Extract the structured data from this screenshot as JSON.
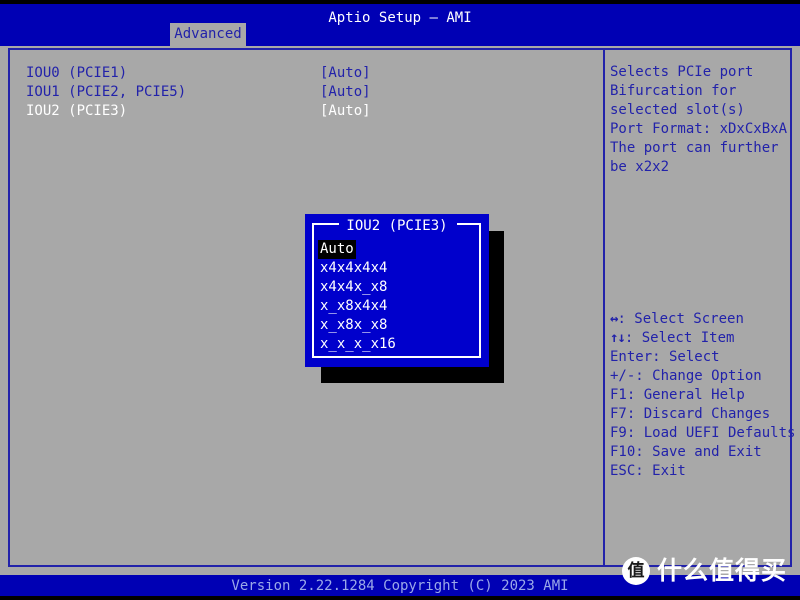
{
  "header": {
    "title": "Aptio Setup – AMI",
    "tab_label": "Advanced"
  },
  "settings": {
    "rows": [
      {
        "label": "IOU0 (PCIE1)",
        "value": "[Auto]",
        "active": false
      },
      {
        "label": "IOU1 (PCIE2, PCIE5)",
        "value": "[Auto]",
        "active": false
      },
      {
        "label": "IOU2 (PCIE3)",
        "value": "[Auto]",
        "active": true
      }
    ]
  },
  "help": {
    "lines": [
      "Selects PCIe port",
      "Bifurcation for",
      "selected slot(s)",
      "Port Format: xDxCxBxA",
      "The port can further",
      "be x2x2"
    ]
  },
  "keys": {
    "lines": [
      {
        "glyph": "↔",
        "text": ": Select Screen"
      },
      {
        "glyph": "↑↓",
        "text": ": Select Item"
      },
      {
        "glyph": "",
        "text": "Enter: Select"
      },
      {
        "glyph": "",
        "text": "+/-: Change Option"
      },
      {
        "glyph": "",
        "text": "F1: General Help"
      },
      {
        "glyph": "",
        "text": "F7: Discard Changes"
      },
      {
        "glyph": "",
        "text": "F9: Load UEFI Defaults"
      },
      {
        "glyph": "",
        "text": "F10: Save and Exit"
      },
      {
        "glyph": "",
        "text": "ESC: Exit"
      }
    ]
  },
  "popup": {
    "title": "IOU2 (PCIE3)",
    "options": [
      {
        "label": "Auto",
        "selected": true
      },
      {
        "label": "x4x4x4x4",
        "selected": false
      },
      {
        "label": "x4x4x_x8",
        "selected": false
      },
      {
        "label": "x_x8x4x4",
        "selected": false
      },
      {
        "label": "x_x8x_x8",
        "selected": false
      },
      {
        "label": "x_x_x_x16",
        "selected": false
      }
    ]
  },
  "footer": {
    "text": "Version 2.22.1284 Copyright (C) 2023 AMI"
  },
  "watermark": {
    "badge": "值",
    "text": "什么值得买"
  },
  "colors": {
    "background": "#a8a8a8",
    "header_blue": "#0000b4",
    "text_blue": "#2222aa",
    "popup_blue": "#0000cc",
    "highlight": "#000000",
    "white": "#ffffff",
    "footer_text": "#9aa8e8"
  }
}
